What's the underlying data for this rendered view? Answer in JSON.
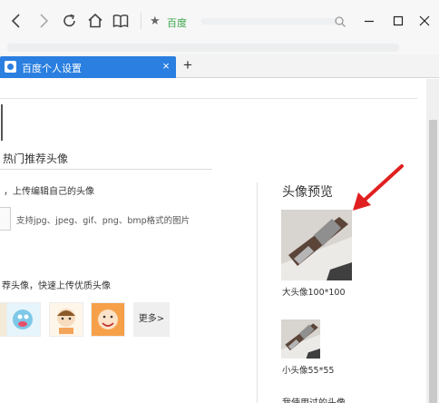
{
  "browser": {
    "site_name": "百度",
    "tab": {
      "title": "百度个人设置",
      "close": "×"
    },
    "new_tab": "+"
  },
  "page": {
    "hot_section": {
      "title": "热门推荐头像",
      "upload_hint": "，上传编辑自己的头像",
      "upload_formats": "支持jpg、jpeg、gif、png、bmp格式的图片",
      "hot_desc": "荐头像，快速上传优质头像",
      "more_label": "更多>"
    },
    "preview": {
      "title": "头像预览",
      "large_caption": "大头像100*100",
      "small_caption": "小头像55*55",
      "used_title": "我使用过的头像"
    }
  },
  "colors": {
    "tab_accent": "#2a7fe0",
    "site_green": "#3aa54a",
    "annotation_red": "#e02020"
  },
  "icons": [
    "back-arrow-icon",
    "forward-arrow-icon",
    "refresh-icon",
    "home-icon",
    "reader-icon",
    "star-icon",
    "search-icon",
    "minimize-icon",
    "maximize-icon",
    "close-icon",
    "baidu-favicon-icon",
    "plus-icon"
  ]
}
